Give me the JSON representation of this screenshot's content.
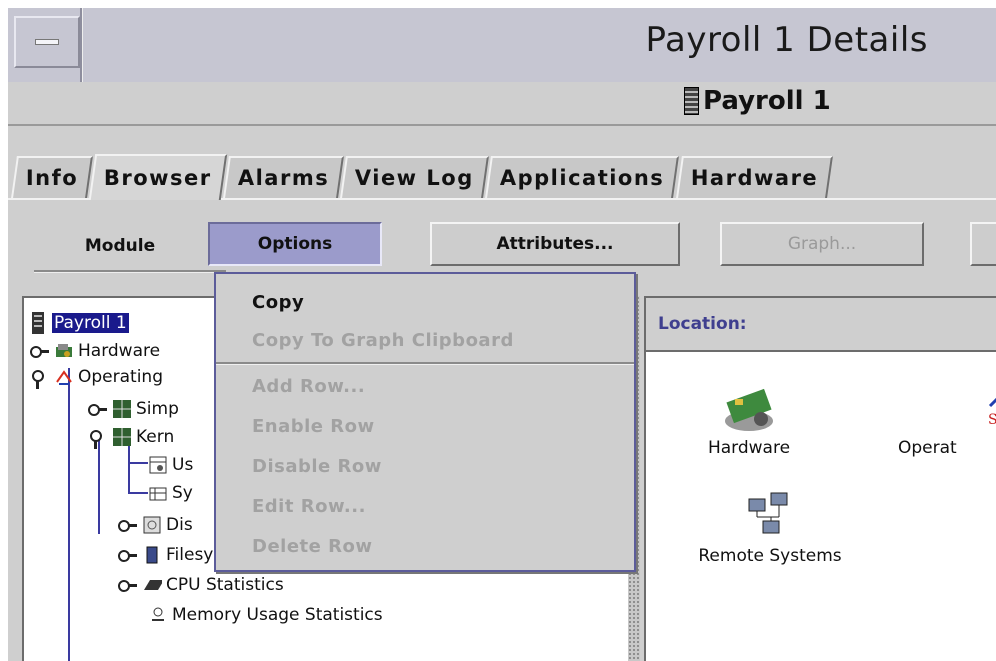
{
  "window": {
    "title": "Payroll 1 Details",
    "host": "Payroll 1"
  },
  "tabs": [
    {
      "label": "Info"
    },
    {
      "label": "Browser"
    },
    {
      "label": "Alarms"
    },
    {
      "label": "View Log"
    },
    {
      "label": "Applications"
    },
    {
      "label": "Hardware"
    }
  ],
  "toolbar": {
    "module": "Module",
    "options": "Options",
    "attributes": "Attributes...",
    "graph": "Graph..."
  },
  "options_menu": {
    "items": [
      {
        "label": "Copy",
        "enabled": true
      },
      {
        "label": "Copy To Graph Clipboard",
        "enabled": false
      },
      {
        "label": "Add Row...",
        "enabled": false
      },
      {
        "label": "Enable Row",
        "enabled": false
      },
      {
        "label": "Disable Row",
        "enabled": false
      },
      {
        "label": "Edit Row...",
        "enabled": false
      },
      {
        "label": "Delete Row",
        "enabled": false
      }
    ]
  },
  "tree": {
    "root": "Payroll 1",
    "rows": [
      {
        "label": "Hardware"
      },
      {
        "label": "Operating"
      },
      {
        "label": "Simp"
      },
      {
        "label": "Kern"
      },
      {
        "label": "Us"
      },
      {
        "label": "Sy"
      },
      {
        "label": "Dis"
      },
      {
        "label": "Filesystem Usage"
      },
      {
        "label": "CPU Statistics"
      },
      {
        "label": "Memory Usage Statistics"
      }
    ]
  },
  "location_panel": {
    "label": "Location:",
    "items": [
      {
        "label": "Hardware",
        "icon": "hardware-card-icon"
      },
      {
        "label": "Operat",
        "icon": "solaris-logo-icon"
      },
      {
        "label": "Remote Systems",
        "icon": "network-computers-icon"
      }
    ]
  },
  "colors": {
    "selection": "#1a1a8c",
    "pressed_button": "#9b9bcb",
    "location_label": "#3f3f8f",
    "disabled_text": "#a2a2a2"
  }
}
